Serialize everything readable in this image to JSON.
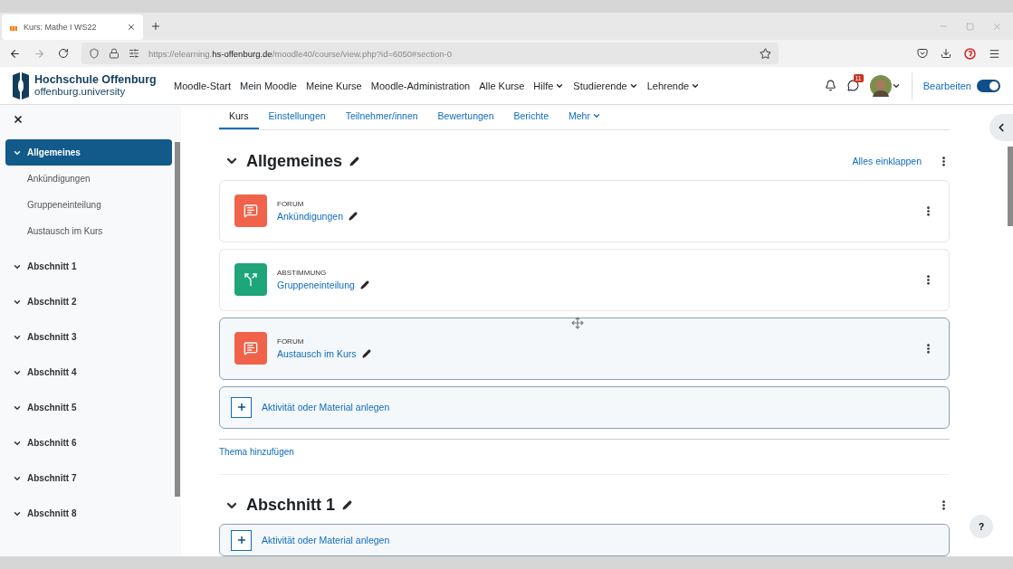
{
  "browser": {
    "tab_title": "Kurs: Mathe I WS22",
    "url_prefix": "https://elearning.",
    "url_domain": "hs-offenburg.de",
    "url_path": "/moodle40/course/view.php?id=6050#section-0"
  },
  "header": {
    "logo_title": "Hochschule Offenburg",
    "logo_subtitle": "offenburg.university",
    "nav": [
      {
        "label": "Moodle-Start",
        "dropdown": false
      },
      {
        "label": "Mein Moodle",
        "dropdown": false
      },
      {
        "label": "Meine Kurse",
        "dropdown": false
      },
      {
        "label": "Moodle-Administration",
        "dropdown": false
      },
      {
        "label": "Alle Kurse",
        "dropdown": false
      },
      {
        "label": "Hilfe",
        "dropdown": true
      },
      {
        "label": "Studierende",
        "dropdown": true
      },
      {
        "label": "Lehrende",
        "dropdown": true
      }
    ],
    "message_count": "11",
    "edit_mode": {
      "label": "Bearbeiten",
      "on": true
    }
  },
  "course_index": [
    {
      "title": "Allgemeines",
      "selected": true,
      "children": [
        {
          "title": "Ankündigungen"
        },
        {
          "title": "Gruppeneinteilung"
        },
        {
          "title": "Austausch im Kurs"
        }
      ]
    },
    {
      "title": "Abschnitt 1",
      "selected": false
    },
    {
      "title": "Abschnitt 2",
      "selected": false
    },
    {
      "title": "Abschnitt 3",
      "selected": false
    },
    {
      "title": "Abschnitt 4",
      "selected": false
    },
    {
      "title": "Abschnitt 5",
      "selected": false
    },
    {
      "title": "Abschnitt 6",
      "selected": false
    },
    {
      "title": "Abschnitt 7",
      "selected": false
    },
    {
      "title": "Abschnitt 8",
      "selected": false
    }
  ],
  "course_tabs": [
    {
      "label": "Kurs",
      "selected": true,
      "dropdown": false
    },
    {
      "label": "Einstellungen",
      "selected": false,
      "dropdown": false
    },
    {
      "label": "Teilnehmer/innen",
      "selected": false,
      "dropdown": false
    },
    {
      "label": "Bewertungen",
      "selected": false,
      "dropdown": false
    },
    {
      "label": "Berichte",
      "selected": false,
      "dropdown": false
    },
    {
      "label": "Mehr",
      "selected": false,
      "dropdown": true
    }
  ],
  "collapse_all": "Alles einklappen",
  "sections": [
    {
      "title": "Allgemeines",
      "activities": [
        {
          "kind": "forum",
          "type_label": "FORUM",
          "name": "Ankündigungen",
          "highlighted": false
        },
        {
          "kind": "choice",
          "type_label": "ABSTIMMUNG",
          "name": "Gruppeneinteilung",
          "highlighted": false
        },
        {
          "kind": "forum",
          "type_label": "FORUM",
          "name": "Austausch im Kurs",
          "highlighted": true
        }
      ],
      "add_label": "Aktivität oder Material anlegen",
      "add_topic": "Thema hinzufügen"
    },
    {
      "title": "Abschnitt 1",
      "add_label": "Aktivität oder Material anlegen"
    }
  ],
  "help_button": "?"
}
